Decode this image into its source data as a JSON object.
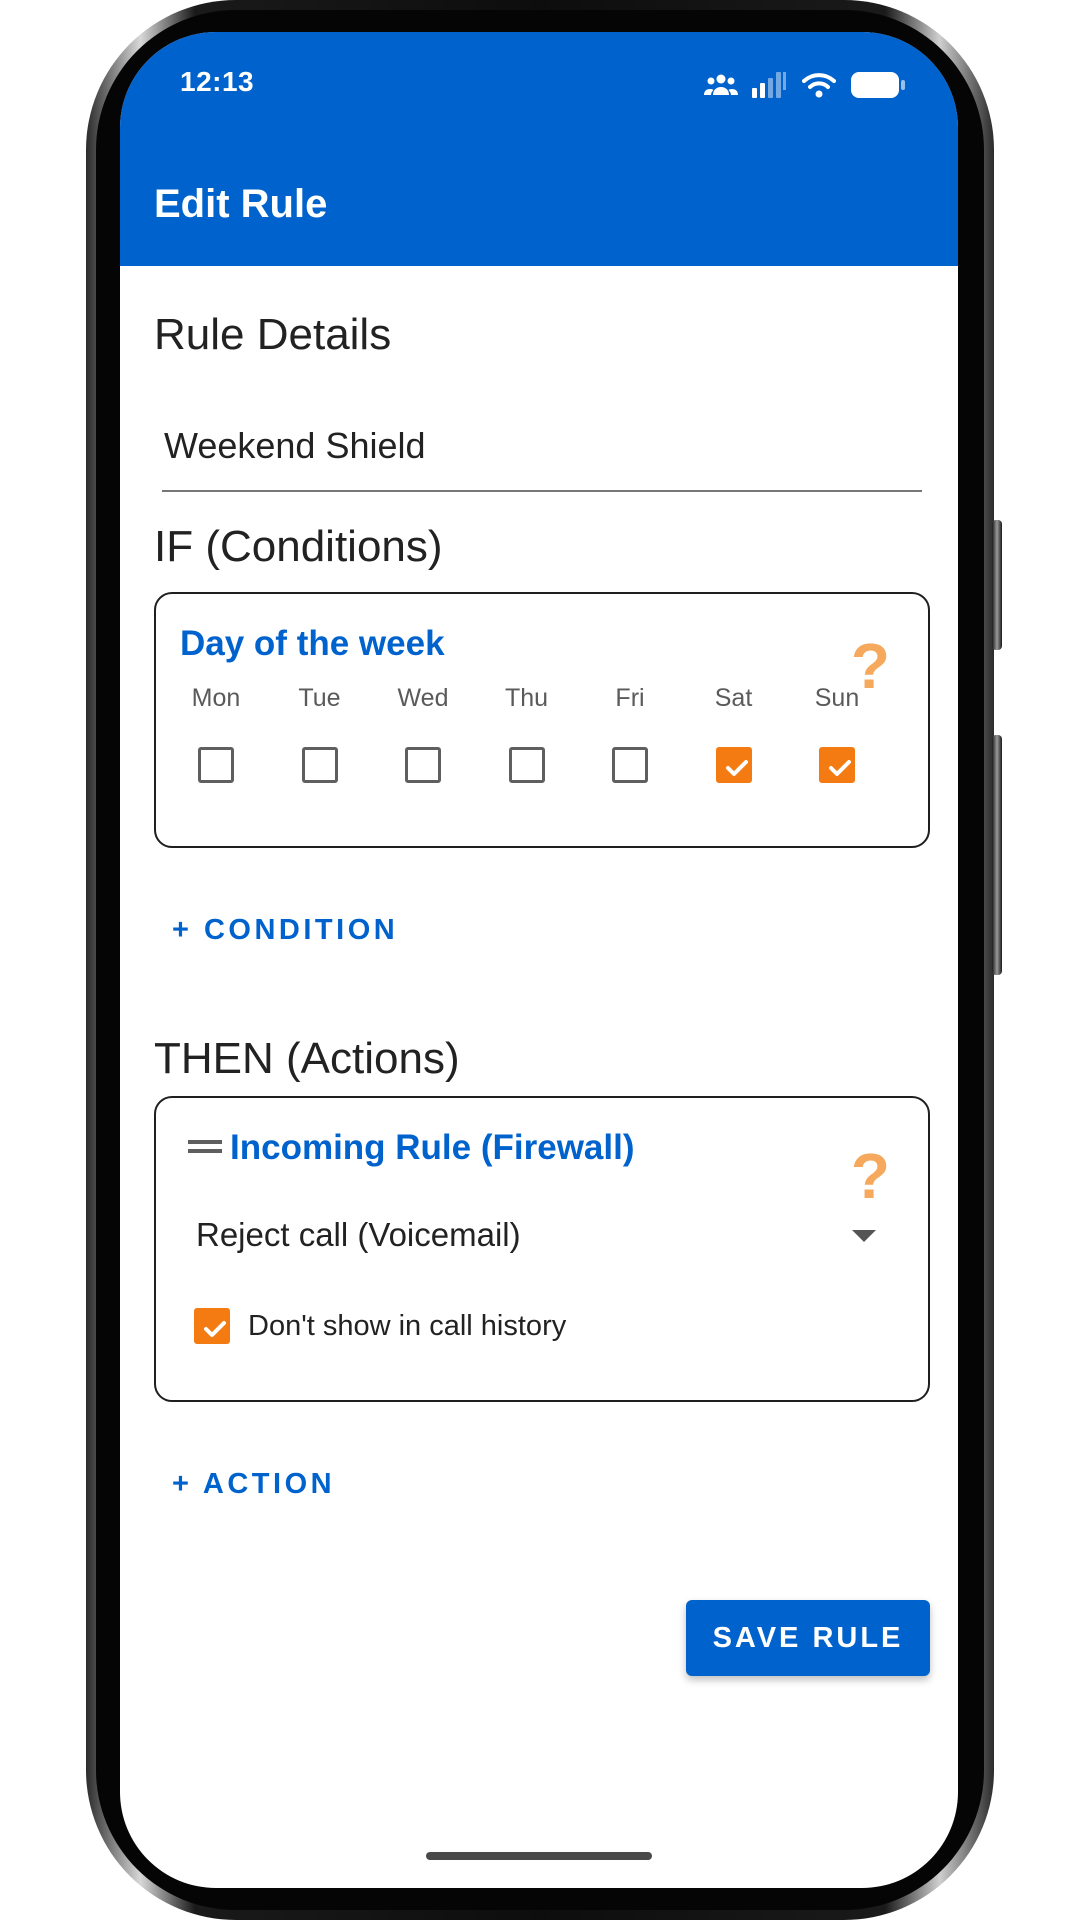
{
  "status_bar": {
    "time": "12:13",
    "icons": [
      "people-icon",
      "signal-icon",
      "wifi-icon",
      "battery-icon"
    ]
  },
  "app_bar": {
    "title": "Edit Rule"
  },
  "rule_details": {
    "heading": "Rule Details",
    "name_value": "Weekend Shield"
  },
  "conditions": {
    "heading": "IF (Conditions)",
    "card": {
      "title": "Day of the week",
      "days": [
        {
          "label": "Mon",
          "checked": false
        },
        {
          "label": "Tue",
          "checked": false
        },
        {
          "label": "Wed",
          "checked": false
        },
        {
          "label": "Thu",
          "checked": false
        },
        {
          "label": "Fri",
          "checked": false
        },
        {
          "label": "Sat",
          "checked": true
        },
        {
          "label": "Sun",
          "checked": true
        }
      ]
    },
    "add_label": "+ CONDITION"
  },
  "actions": {
    "heading": "THEN (Actions)",
    "card": {
      "title": "Incoming Rule (Firewall)",
      "selected_action": "Reject call (Voicemail)",
      "option_label": "Don't show in call history",
      "option_checked": true
    },
    "add_label": "+ ACTION"
  },
  "save_label": "SAVE RULE",
  "colors": {
    "primary": "#0062cc",
    "accent": "#f47a12",
    "help": "#f6a95c"
  }
}
